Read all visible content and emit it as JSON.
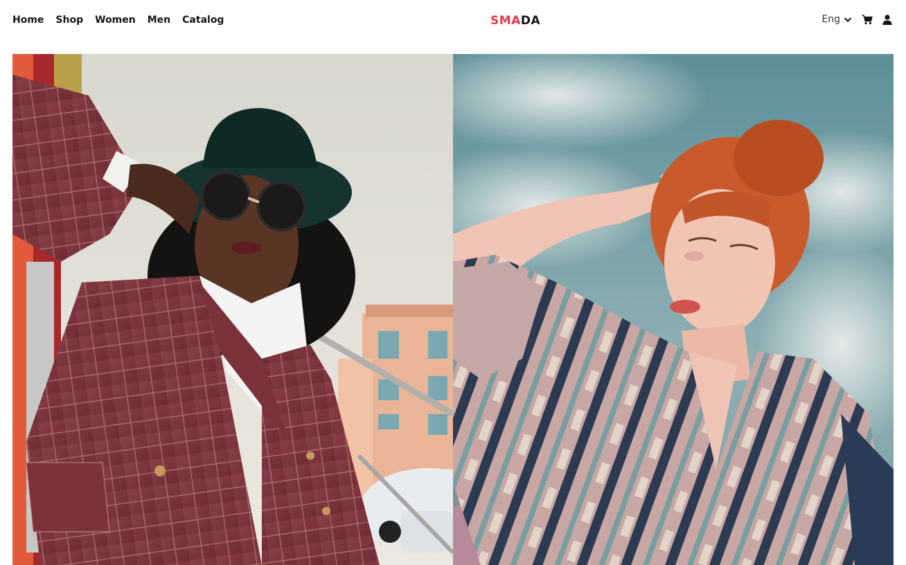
{
  "nav": {
    "items": [
      {
        "label": "Home"
      },
      {
        "label": "Shop"
      },
      {
        "label": "Women"
      },
      {
        "label": "Men"
      },
      {
        "label": "Catalog"
      }
    ]
  },
  "brand": {
    "part1": "SMA",
    "part2": "DA",
    "accent_color": "#e8394a"
  },
  "toolbar": {
    "language": "Eng",
    "icons": [
      "chevron-down-icon",
      "cart-icon",
      "user-icon"
    ]
  }
}
